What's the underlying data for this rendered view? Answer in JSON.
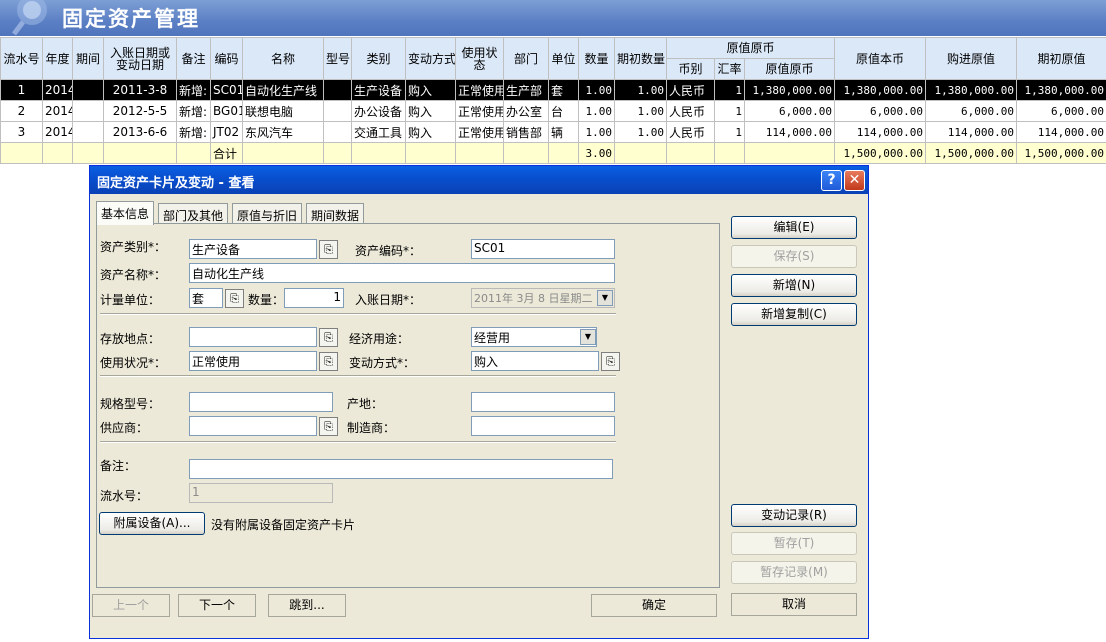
{
  "banner": {
    "title": "固定资产管理"
  },
  "table": {
    "headers": {
      "serial": "流水号",
      "year": "年度",
      "period": "期间",
      "entry_date": "入账日期或变动日期",
      "remark": "备注",
      "code": "编码",
      "name": "名称",
      "model": "型号",
      "category": "类别",
      "change_mode": "变动方式",
      "usage": "使用状态",
      "dept": "部门",
      "unit": "单位",
      "qty": "数量",
      "init_qty": "期初数量",
      "orig_group": "原值原币",
      "currency": "币别",
      "rate": "汇率",
      "orig_foreign": "原值原币",
      "orig_local": "原值本币",
      "purchase": "购进原值",
      "init_value": "期初原值"
    },
    "rows": [
      {
        "serial": "1",
        "year": "2014",
        "period": "",
        "date": "2011-3-8",
        "remark": "新增:",
        "code": "SC01",
        "name": "自动化生产线",
        "model": "",
        "category": "生产设备",
        "change_mode": "购入",
        "usage": "正常使用",
        "dept": "生产部",
        "unit": "套",
        "qty": "1.00",
        "init_qty": "1.00",
        "currency": "人民币",
        "rate": "1",
        "orig_foreign": "1,380,000.00",
        "orig_local": "1,380,000.00",
        "purchase": "1,380,000.00",
        "init_value": "1,380,000.00"
      },
      {
        "serial": "2",
        "year": "2014",
        "period": "",
        "date": "2012-5-5",
        "remark": "新增:",
        "code": "BG01",
        "name": "联想电脑",
        "model": "",
        "category": "办公设备",
        "change_mode": "购入",
        "usage": "正常使用",
        "dept": "办公室",
        "unit": "台",
        "qty": "1.00",
        "init_qty": "1.00",
        "currency": "人民币",
        "rate": "1",
        "orig_foreign": "6,000.00",
        "orig_local": "6,000.00",
        "purchase": "6,000.00",
        "init_value": "6,000.00"
      },
      {
        "serial": "3",
        "year": "2014",
        "period": "",
        "date": "2013-6-6",
        "remark": "新增:",
        "code": "JT02",
        "name": "东风汽车",
        "model": "",
        "category": "交通工具",
        "change_mode": "购入",
        "usage": "正常使用",
        "dept": "销售部",
        "unit": "辆",
        "qty": "1.00",
        "init_qty": "1.00",
        "currency": "人民币",
        "rate": "1",
        "orig_foreign": "114,000.00",
        "orig_local": "114,000.00",
        "purchase": "114,000.00",
        "init_value": "114,000.00"
      }
    ],
    "total": {
      "label": "合计",
      "qty": "3.00",
      "orig_local": "1,500,000.00",
      "purchase": "1,500,000.00",
      "init_value": "1,500,000.00"
    }
  },
  "dialog": {
    "title": "固定资产卡片及变动 - 查看",
    "help": "?",
    "close": "✕",
    "tabs": [
      "基本信息",
      "部门及其他",
      "原值与折旧",
      "期间数据"
    ],
    "fields": {
      "asset_category_label": "资产类别*：",
      "asset_category": "生产设备",
      "asset_code_label": "资产编码*：",
      "asset_code": "SC01",
      "asset_name_label": "资产名称*：",
      "asset_name": "自动化生产线",
      "unit_label": "计量单位：",
      "unit": "套",
      "qty_label": "数量：",
      "qty": "1",
      "entry_date_label": "入账日期*：",
      "entry_date": "2011年 3月 8 日星期二",
      "location_label": "存放地点：",
      "location": "",
      "econ_use_label": "经济用途：",
      "econ_use": "经营用",
      "usage_label": "使用状况*：",
      "usage": "正常使用",
      "change_mode_label": "变动方式*：",
      "change_mode": "购入",
      "spec_label": "规格型号：",
      "spec": "",
      "origin_label": "产地：",
      "origin": "",
      "supplier_label": "供应商：",
      "supplier": "",
      "maker_label": "制造商：",
      "maker": "",
      "remark_label": "备注：",
      "remark": "",
      "serial_label": "流水号：",
      "serial": "1",
      "attach_button": "附属设备(A)...",
      "attach_note": "没有附属设备固定资产卡片"
    },
    "buttons": {
      "edit": "编辑(E)",
      "save": "保存(S)",
      "add": "新增(N)",
      "add_copy": "新增复制(C)",
      "change_log": "变动记录(R)",
      "hold": "暂存(T)",
      "hold_log": "暂存记录(M)",
      "prev": "上一个",
      "next": "下一个",
      "jump": "跳到...",
      "ok": "确定",
      "cancel": "取消"
    }
  }
}
